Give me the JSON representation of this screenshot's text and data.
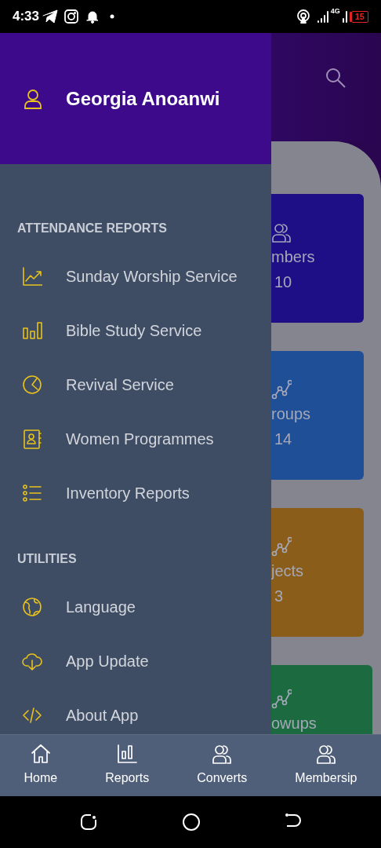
{
  "status_bar": {
    "time": "4:33",
    "network": "4G",
    "battery": "15"
  },
  "app_background": {
    "cards": [
      {
        "kind": "people",
        "label": "mbers",
        "value": "10",
        "color": "#1f0f86"
      },
      {
        "kind": "chart",
        "label": "roups",
        "value": "14",
        "color": "#1f4f96"
      },
      {
        "kind": "chart",
        "label": "jects",
        "value": "3",
        "color": "#8a5d1a"
      },
      {
        "kind": "chart",
        "label": "owups",
        "color": "#1c6a3f"
      }
    ]
  },
  "drawer": {
    "user_name": "Georgia Anoanwi",
    "sections": [
      {
        "title": "ATTENDANCE REPORTS",
        "items": [
          {
            "label": "Sunday Worship Service"
          },
          {
            "label": "Bible Study Service"
          },
          {
            "label": "Revival Service"
          },
          {
            "label": "Women Programmes"
          },
          {
            "label": "Inventory Reports"
          }
        ]
      },
      {
        "title": "UTILITIES",
        "items": [
          {
            "label": "Language"
          },
          {
            "label": "App Update"
          },
          {
            "label": "About App"
          }
        ]
      }
    ]
  },
  "bottom_nav": [
    {
      "label": "Home"
    },
    {
      "label": "Reports"
    },
    {
      "label": "Converts"
    },
    {
      "label": "Membersip"
    }
  ]
}
